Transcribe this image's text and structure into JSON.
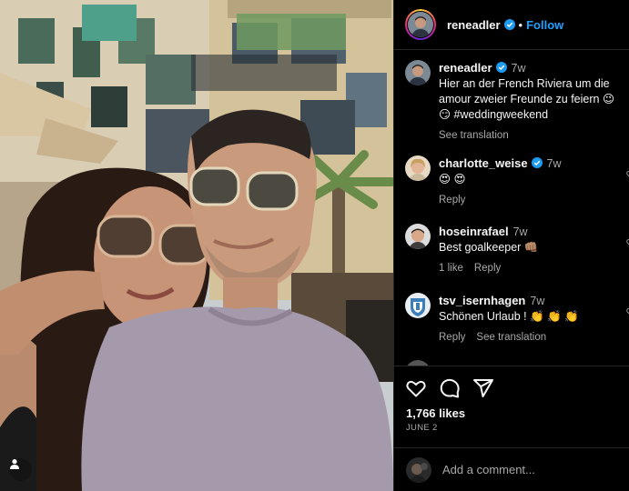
{
  "colors": {
    "accent": "#1ea0ff",
    "muted": "#a8a8a8",
    "background": "#000000",
    "verified": "#1d9bf0"
  },
  "header": {
    "username": "reneadler",
    "separator": "•",
    "follow_label": "Follow"
  },
  "caption": {
    "username": "reneadler",
    "age": "7w",
    "text": "Hier an der French Riviera um die amour zweier Freunde zu feiern 😉 😏 #weddingweekend",
    "see_translation": "See translation"
  },
  "comments": [
    {
      "username": "charlotte_weise",
      "verified": true,
      "age": "7w",
      "text": "😍 😍",
      "meta": [
        "Reply"
      ]
    },
    {
      "username": "hoseinrafael",
      "verified": false,
      "age": "7w",
      "text": "Best goalkeeper 👊🏽",
      "meta": [
        "1 like",
        "Reply"
      ]
    },
    {
      "username": "tsv_isernhagen",
      "verified": false,
      "age": "7w",
      "text": "Schönen Urlaub ! 👏 👏 👏",
      "meta": [
        "Reply",
        "See translation"
      ]
    }
  ],
  "actions": {
    "icons": [
      "heart-icon",
      "comment-icon",
      "share-icon"
    ],
    "likes": "1,766 likes",
    "date": "JUNE 2"
  },
  "add_comment": {
    "placeholder": "Add a comment..."
  }
}
